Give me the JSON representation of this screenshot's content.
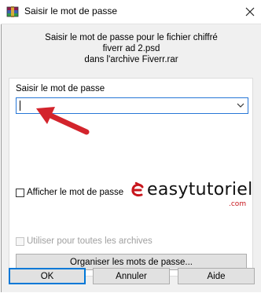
{
  "window": {
    "title": "Saisir le mot de passe",
    "icon": "winrar-icon",
    "close_icon": "close-icon"
  },
  "info": {
    "line1": "Saisir le mot de passe pour le fichier chiffré",
    "line2": "fiverr ad 2.psd",
    "line3": "dans l'archive Fiverr.rar"
  },
  "password": {
    "label": "Saisir le mot de passe",
    "value": "",
    "placeholder": ""
  },
  "show_password": {
    "label": "Afficher le mot de passe",
    "checked": false
  },
  "use_for_all": {
    "label": "Utiliser pour toutes les archives",
    "checked": false,
    "disabled": true
  },
  "organize_button": {
    "label": "Organiser les mots de passe..."
  },
  "watermark": {
    "brand": "easytutoriel",
    "domain": ".com",
    "color": "#c8161d"
  },
  "buttons": {
    "ok": "OK",
    "cancel": "Annuler",
    "help": "Aide"
  },
  "colors": {
    "accent": "#0078d7",
    "annotation_arrow": "#d3242c"
  }
}
